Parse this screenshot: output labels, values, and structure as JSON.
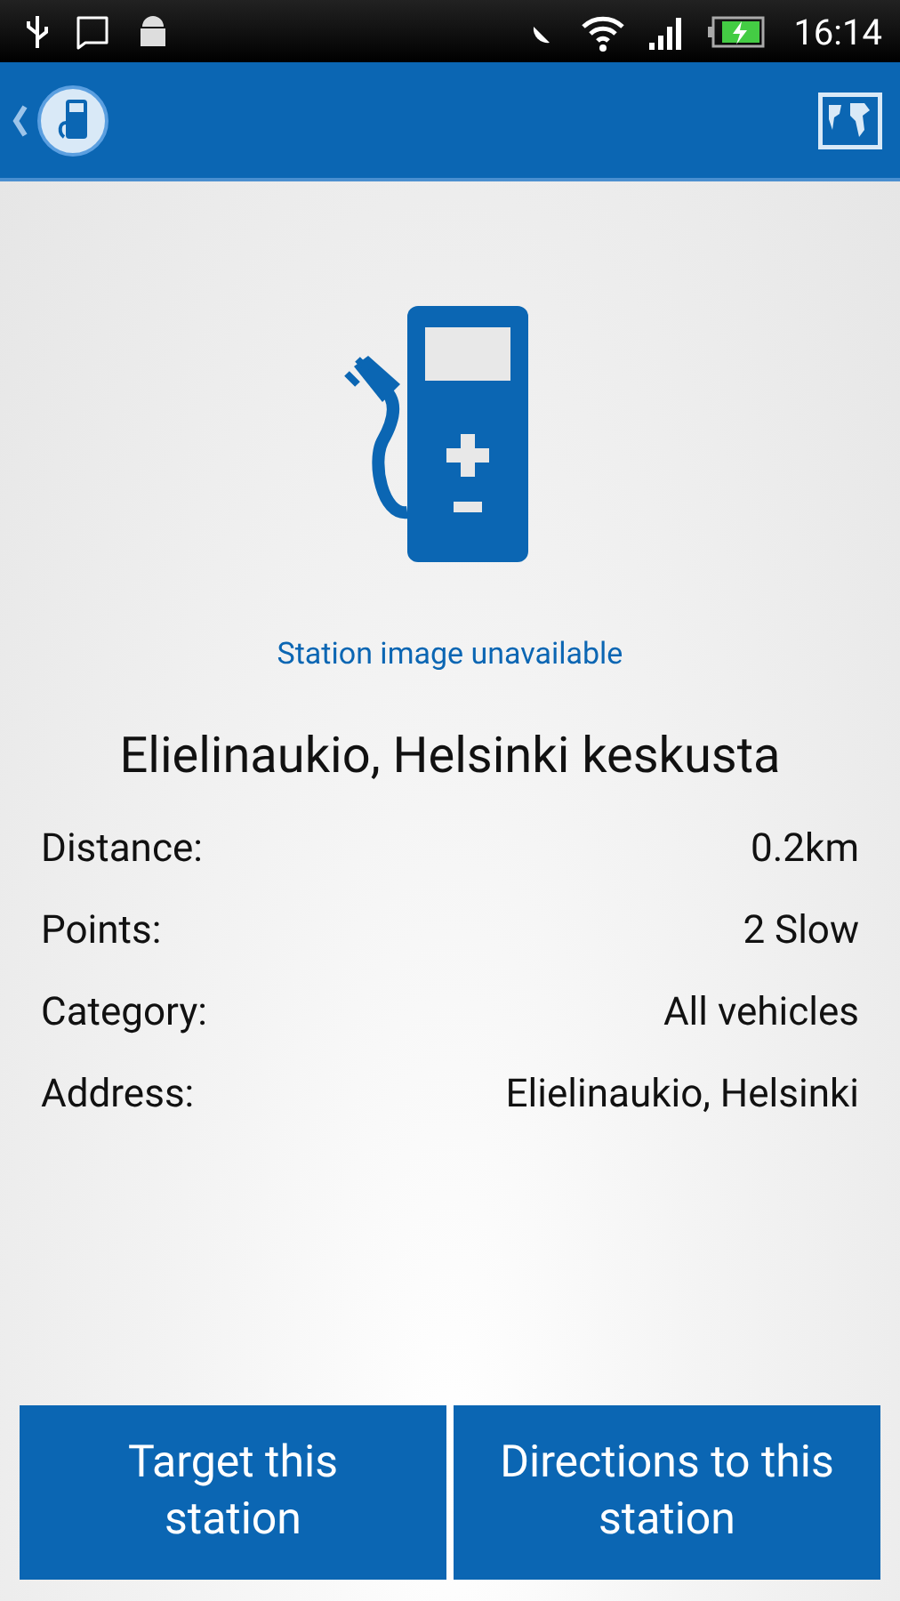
{
  "status_bar": {
    "time": "16:14"
  },
  "image_caption": "Station image unavailable",
  "station_name": "Elielinaukio, Helsinki keskusta",
  "details": [
    {
      "label": "Distance:",
      "value": "0.2km"
    },
    {
      "label": "Points:",
      "value": "2 Slow"
    },
    {
      "label": "Category:",
      "value": "All vehicles"
    },
    {
      "label": "Address:",
      "value": "Elielinaukio, Helsinki"
    }
  ],
  "buttons": [
    {
      "label": "Target this station"
    },
    {
      "label": "Directions to this station"
    }
  ]
}
